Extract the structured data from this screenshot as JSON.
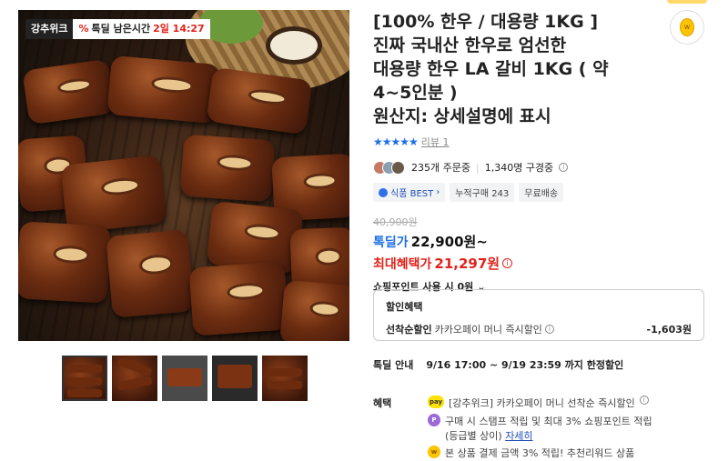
{
  "image": {
    "brand_badge": "강추위크",
    "time_pct_icon": "%",
    "time_label": "톡딜 남은시간",
    "time_value": "2일 14:27"
  },
  "thumbnails": [
    {
      "name": "thumb-1",
      "active": true
    },
    {
      "name": "thumb-2",
      "active": false
    },
    {
      "name": "thumb-3",
      "active": false
    },
    {
      "name": "thumb-4",
      "active": false
    },
    {
      "name": "thumb-5",
      "active": false
    }
  ],
  "product": {
    "title_lines": [
      "[100% 한우 / 대용량 1KG ]",
      "진짜 국내산 한우로 엄선한",
      "대용량 한우 LA 갈비 1KG ( 약",
      "4~5인분 )",
      "원산지: 상세설명에 표시"
    ],
    "stars": "★★★★★",
    "review_link": "리뷰 1",
    "orders": "235개 주문중",
    "subscribers": "1,340명 구경중",
    "tags": {
      "best": "식품 BEST",
      "best_chevron": "›",
      "cumulative": "누적구매 243",
      "shipping": "무료배송"
    },
    "original_price": "40,900원",
    "deal_label": "톡딜가",
    "deal_price": "22,900원~",
    "max_benefit_label": "최대혜택가",
    "max_benefit_price": "21,297원",
    "points_text": "쇼핑포인트 사용 시 0원",
    "points_chevron": "⌄"
  },
  "discount": {
    "header": "할인혜택",
    "row_label": "선착순할인",
    "row_value": "카카오페이 머니 즉시할인",
    "row_amount": "-1,603원"
  },
  "deal_info": {
    "label": "톡딜 안내",
    "value": "9/16 17:00 ~ 9/19 23:59 까지 한정할인"
  },
  "perks": {
    "label": "혜택",
    "items": [
      {
        "icon": "pay",
        "text": "[강추위크] 카카오페이 머니 선착순 즉시할인"
      },
      {
        "icon": "P",
        "text": "구매 시 스탬프 적립 및 최대 3% 쇼핑포인트 적립",
        "text2": "(등급별 상이)",
        "link": "자세히"
      },
      {
        "icon": "coin",
        "text": "본 상품 결제 금액 3% 적립! 추천리워드 상품"
      }
    ]
  },
  "colors": {
    "accent_blue": "#1f6fe6",
    "accent_red": "#e2231a"
  }
}
